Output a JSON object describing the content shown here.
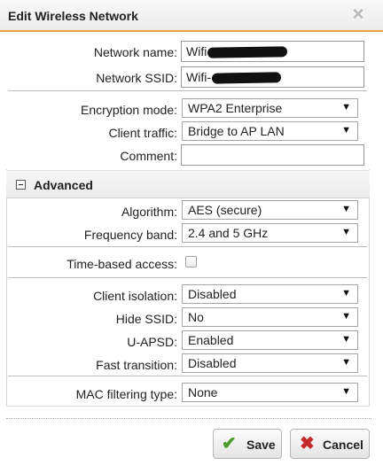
{
  "dialog": {
    "title": "Edit Wireless Network",
    "close_icon": "×"
  },
  "fields": {
    "network_name": {
      "label": "Network name:",
      "value": "Wifi"
    },
    "network_ssid": {
      "label": "Network SSID:",
      "value": "Wifi-"
    },
    "encryption_mode": {
      "label": "Encryption mode:",
      "value": "WPA2 Enterprise"
    },
    "client_traffic": {
      "label": "Client traffic:",
      "value": "Bridge to AP LAN"
    },
    "comment": {
      "label": "Comment:",
      "value": ""
    }
  },
  "advanced": {
    "title": "Advanced",
    "algorithm": {
      "label": "Algorithm:",
      "value": "AES (secure)"
    },
    "frequency_band": {
      "label": "Frequency band:",
      "value": "2.4 and 5 GHz"
    },
    "time_based_access": {
      "label": "Time-based access:",
      "checked": false
    },
    "client_isolation": {
      "label": "Client isolation:",
      "value": "Disabled"
    },
    "hide_ssid": {
      "label": "Hide SSID:",
      "value": "No"
    },
    "u_apsd": {
      "label": "U-APSD:",
      "value": "Enabled"
    },
    "fast_transition": {
      "label": "Fast transition:",
      "value": "Disabled"
    },
    "mac_filtering_type": {
      "label": "MAC filtering type:",
      "value": "None"
    }
  },
  "buttons": {
    "save": "Save",
    "cancel": "Cancel"
  },
  "icons": {
    "dropdown": "chevron-down-icon",
    "save": "checkmark-icon",
    "cancel": "x-icon",
    "collapse": "collapse-minus-icon"
  },
  "colors": {
    "title_underline": "#e8a33c",
    "save_icon": "#4a9b2a",
    "cancel_icon": "#c62a2a"
  }
}
